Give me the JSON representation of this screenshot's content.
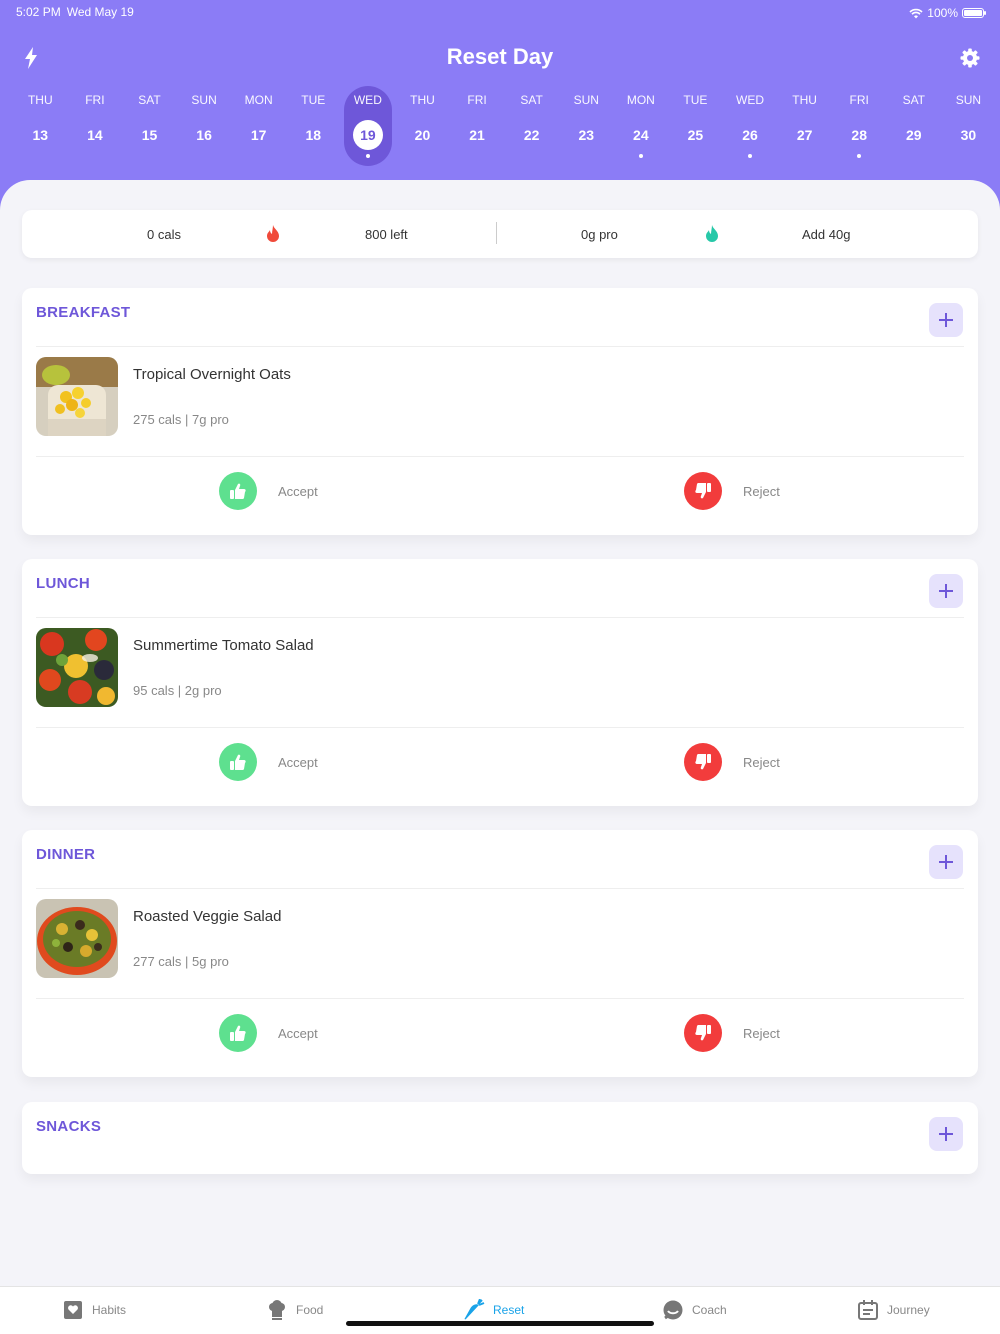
{
  "status": {
    "time": "5:02 PM",
    "date": "Wed May 19",
    "battery": "100%"
  },
  "header": {
    "title": "Reset Day",
    "bolt_icon": "bolt-icon",
    "settings_icon": "gear-icon"
  },
  "days": [
    {
      "dow": "THU",
      "num": "13"
    },
    {
      "dow": "FRI",
      "num": "14"
    },
    {
      "dow": "SAT",
      "num": "15"
    },
    {
      "dow": "SUN",
      "num": "16"
    },
    {
      "dow": "MON",
      "num": "17"
    },
    {
      "dow": "TUE",
      "num": "18"
    },
    {
      "dow": "WED",
      "num": "19"
    },
    {
      "dow": "THU",
      "num": "20"
    },
    {
      "dow": "FRI",
      "num": "21"
    },
    {
      "dow": "SAT",
      "num": "22"
    },
    {
      "dow": "SUN",
      "num": "23"
    },
    {
      "dow": "MON",
      "num": "24"
    },
    {
      "dow": "TUE",
      "num": "25"
    },
    {
      "dow": "WED",
      "num": "26"
    },
    {
      "dow": "THU",
      "num": "27"
    },
    {
      "dow": "FRI",
      "num": "28"
    },
    {
      "dow": "SAT",
      "num": "29"
    },
    {
      "dow": "SUN",
      "num": "30"
    }
  ],
  "summary": {
    "cals": "0 cals",
    "cals_left": "800 left",
    "protein": "0g pro",
    "protein_add": "Add 40g",
    "cal_color": "#f04a3a",
    "pro_color": "#27c8a8"
  },
  "meals": [
    {
      "title": "BREAKFAST",
      "recipe": "Tropical Overnight Oats",
      "info": "275 cals | 7g pro",
      "accept": "Accept",
      "reject": "Reject"
    },
    {
      "title": "LUNCH",
      "recipe": "Summertime Tomato Salad",
      "info": "95 cals | 2g pro",
      "accept": "Accept",
      "reject": "Reject"
    },
    {
      "title": "DINNER",
      "recipe": "Roasted Veggie Salad",
      "info": "277 cals | 5g pro",
      "accept": "Accept",
      "reject": "Reject"
    },
    {
      "title": "SNACKS"
    }
  ],
  "tabs": [
    {
      "label": "Habits",
      "icon": "heart-book-icon"
    },
    {
      "label": "Food",
      "icon": "chef-hat-icon"
    },
    {
      "label": "Reset",
      "icon": "carrot-icon"
    },
    {
      "label": "Coach",
      "icon": "chat-icon"
    },
    {
      "label": "Journey",
      "icon": "calendar-icon"
    }
  ],
  "colors": {
    "accent": "#8b7cf6",
    "accent_dark": "#6e57d9",
    "accept": "#5ee08f",
    "reject": "#f23c3c",
    "tab_active": "#1aa3e8"
  }
}
